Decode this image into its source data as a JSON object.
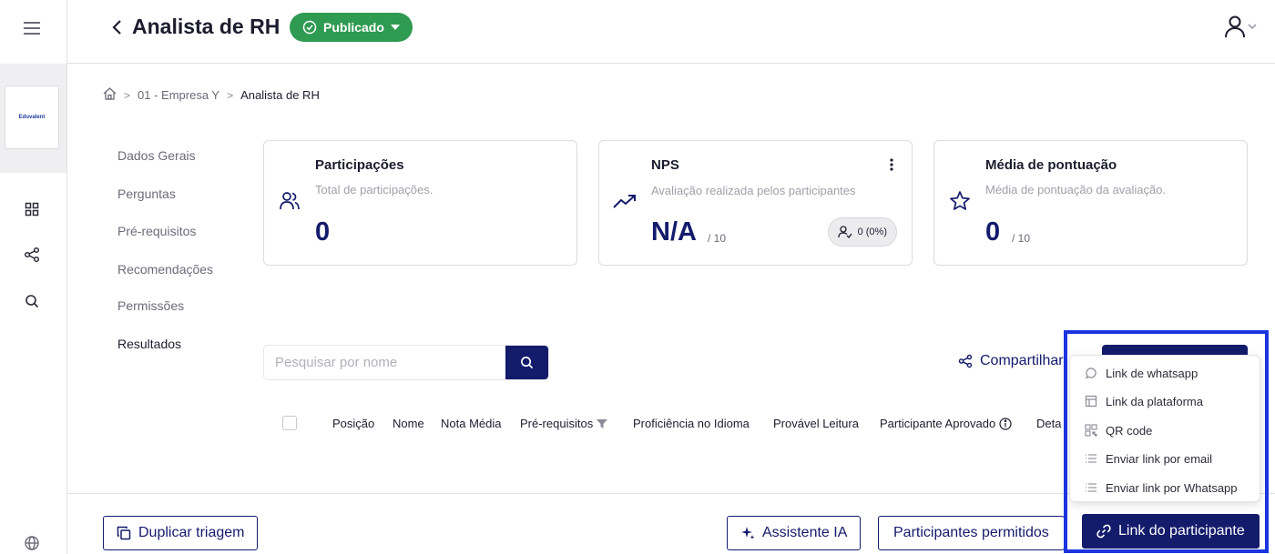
{
  "header": {
    "title": "Analista de RH",
    "status_label": "Publicado"
  },
  "breadcrumb": {
    "items": [
      "01 - Empresa Y",
      "Analista de RH"
    ]
  },
  "rail": {
    "logo_text": "Eduvalent"
  },
  "sidenav": {
    "items": [
      {
        "label": "Dados Gerais"
      },
      {
        "label": "Perguntas"
      },
      {
        "label": "Pré-requisitos"
      },
      {
        "label": "Recomendações"
      },
      {
        "label": "Permissões"
      },
      {
        "label": "Resultados"
      }
    ],
    "active": "Resultados"
  },
  "cards": {
    "participacoes": {
      "title": "Participações",
      "subtitle": "Total de participações.",
      "value": "0"
    },
    "nps": {
      "title": "NPS",
      "subtitle": "Avaliação realizada pelos participantes",
      "value": "N/A",
      "scale": "/ 10",
      "badge": "0 (0%)"
    },
    "media": {
      "title": "Média de pontuação",
      "subtitle": "Média de pontuação da avaliação.",
      "value": "0",
      "scale": "/ 10"
    }
  },
  "search": {
    "placeholder": "Pesquisar por nome"
  },
  "share": {
    "label": "Compartilhar"
  },
  "table": {
    "columns": [
      "Posição",
      "Nome",
      "Nota Média",
      "Pré-requisitos",
      "Proficiência no Idioma",
      "Provável Leitura",
      "Participante Aprovado",
      "Deta"
    ]
  },
  "dropdown": {
    "items": [
      {
        "label": "Link de whatsapp",
        "icon": "whatsapp-icon"
      },
      {
        "label": "Link da plataforma",
        "icon": "layout-icon"
      },
      {
        "label": "QR code",
        "icon": "qr-code-icon"
      },
      {
        "label": "Enviar link por email",
        "icon": "list-icon"
      },
      {
        "label": "Enviar link por Whatsapp",
        "icon": "list-icon"
      }
    ]
  },
  "footer": {
    "duplicate_label": "Duplicar triagem",
    "assistant_label": "Assistente IA",
    "allowed_label": "Participantes permitidos",
    "link_label": "Link do participante"
  },
  "colors": {
    "primary": "#131b6b",
    "success": "#2f9a52",
    "highlight": "#1a35e0"
  }
}
